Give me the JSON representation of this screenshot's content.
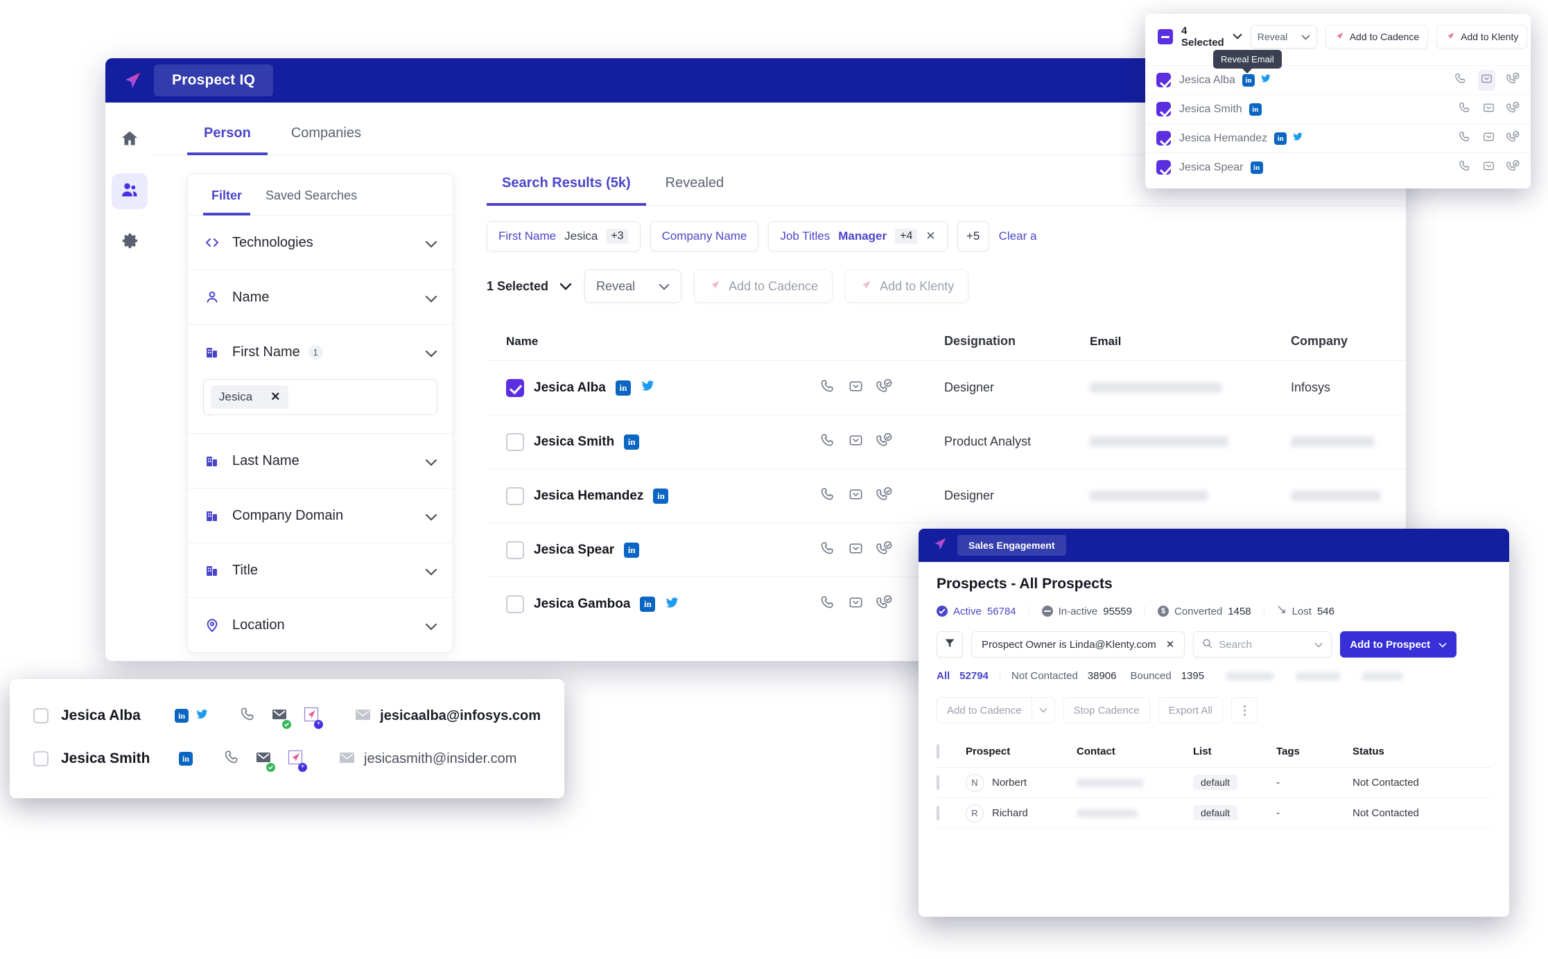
{
  "app": {
    "title": "Prospect IQ",
    "logo": "paper-plane-logo"
  },
  "rail": {
    "items": [
      {
        "name": "home",
        "icon": "home-icon",
        "active": false
      },
      {
        "name": "people",
        "icon": "people-icon",
        "active": true
      },
      {
        "name": "settings",
        "icon": "gear-icon",
        "active": false
      }
    ]
  },
  "top_tabs": [
    {
      "label": "Person",
      "active": true
    },
    {
      "label": "Companies",
      "active": false
    }
  ],
  "filter_panel": {
    "tabs": [
      {
        "label": "Filter",
        "active": true
      },
      {
        "label": "Saved Searches",
        "active": false
      }
    ],
    "rows": [
      {
        "label": "Technologies",
        "icon": "code-icon",
        "count": ""
      },
      {
        "label": "Name",
        "icon": "person-icon",
        "count": ""
      },
      {
        "label": "First Name",
        "icon": "building-icon",
        "count": "1"
      },
      {
        "label": "Last Name",
        "icon": "building-icon",
        "count": ""
      },
      {
        "label": "Company Domain",
        "icon": "building-icon",
        "count": ""
      },
      {
        "label": "Title",
        "icon": "building-icon",
        "count": ""
      },
      {
        "label": "Location",
        "icon": "pin-icon",
        "count": ""
      }
    ],
    "first_name_tag": "Jesica"
  },
  "results": {
    "tabs": [
      {
        "label": "Search Results (5k)",
        "active": true
      },
      {
        "label": "Revealed",
        "active": false
      }
    ],
    "chips": [
      {
        "label": "First Name",
        "value": "Jesica",
        "plus": "+3",
        "removable": false
      },
      {
        "label": "Company Name",
        "value": "",
        "plus": "",
        "removable": false
      },
      {
        "label": "Job Titles",
        "value": "Manager",
        "plus": "+4",
        "removable": true
      }
    ],
    "more_chip": "+5",
    "clear_all": "Clear a",
    "toolbar": {
      "selected": "1 Selected",
      "reveal": "Reveal",
      "add_to_cadence": "Add to Cadence",
      "add_to_klenty": "Add to Klenty"
    },
    "columns": [
      "Name",
      "Designation",
      "Email",
      "Company"
    ],
    "rows": [
      {
        "name": "Jesica Alba",
        "checked": true,
        "socials": [
          "linkedin",
          "twitter"
        ],
        "designation": "Designer",
        "email_blurred": true,
        "company": "Infosys",
        "company_blurred": false
      },
      {
        "name": "Jesica Smith",
        "checked": false,
        "socials": [
          "linkedin"
        ],
        "designation": "Product Analyst",
        "email_blurred": true,
        "company": "",
        "company_blurred": true
      },
      {
        "name": "Jesica Hemandez",
        "checked": false,
        "socials": [
          "linkedin"
        ],
        "designation": "Designer",
        "email_blurred": true,
        "company": "",
        "company_blurred": true
      },
      {
        "name": "Jesica Spear",
        "checked": false,
        "socials": [
          "linkedin"
        ],
        "designation": "",
        "email_blurred": false,
        "company": "",
        "company_blurred": false
      },
      {
        "name": "Jesica Gamboa",
        "checked": false,
        "socials": [
          "linkedin",
          "twitter"
        ],
        "designation": "",
        "email_blurred": false,
        "company": "",
        "company_blurred": false
      }
    ]
  },
  "overlay_top_right": {
    "selected": "4 Selected",
    "reveal": "Reveal",
    "add_to_cadence": "Add to Cadence",
    "add_to_klenty": "Add to Klenty",
    "tooltip": "Reveal Email",
    "rows": [
      {
        "name": "Jesica Alba",
        "socials": [
          "linkedin",
          "twitter"
        ],
        "highlight_email": true
      },
      {
        "name": "Jesica Smith",
        "socials": [
          "linkedin"
        ],
        "highlight_email": false
      },
      {
        "name": "Jesica Hemandez",
        "socials": [
          "linkedin",
          "twitter"
        ],
        "highlight_email": false
      },
      {
        "name": "Jesica Spear",
        "socials": [
          "linkedin"
        ],
        "highlight_email": false
      }
    ]
  },
  "overlay_bottom_left": {
    "rows": [
      {
        "name": "Jesica Alba",
        "socials": [
          "linkedin",
          "twitter"
        ],
        "email": "jesicaalba@infosys.com",
        "bold": true
      },
      {
        "name": "Jesica Smith",
        "socials": [
          "linkedin"
        ],
        "email": "jesicasmith@insider.com",
        "bold": false
      }
    ]
  },
  "overlay_bottom_right": {
    "app_pill": "Sales Engagement",
    "title": "Prospects - All Prospects",
    "stats": [
      {
        "label": "Active",
        "value": "56784",
        "icon": "check-circle-icon",
        "color": "#4a45c9",
        "active": true
      },
      {
        "label": "In-active",
        "value": "95559",
        "icon": "minus-circle-icon",
        "color": "#767c8a",
        "active": false
      },
      {
        "label": "Converted",
        "value": "1458",
        "icon": "dollar-circle-icon",
        "color": "#767c8a",
        "active": false
      },
      {
        "label": "Lost",
        "value": "546",
        "icon": "arrow-down-right-icon",
        "color": "#767c8a",
        "active": false
      }
    ],
    "filter_chip": "Prospect Owner is Linda@Klenty.com",
    "search_placeholder": "Search",
    "add_to_prospect": "Add to Prospect",
    "subfilters": [
      {
        "label": "All",
        "value": "52794",
        "active": true
      },
      {
        "label": "Not Contacted",
        "value": "38906",
        "active": false
      },
      {
        "label": "Bounced",
        "value": "1395",
        "active": false
      }
    ],
    "actions": {
      "add_to_cadence": "Add to Cadence",
      "stop_cadence": "Stop Cadence",
      "export_all": "Export All"
    },
    "columns": [
      "Prospect",
      "Contact",
      "List",
      "Tags",
      "Status"
    ],
    "rows": [
      {
        "initial": "N",
        "prospect": "Norbert",
        "list": "default",
        "tags": "-",
        "status": "Not Contacted"
      },
      {
        "initial": "R",
        "prospect": "Richard",
        "list": "default",
        "tags": "-",
        "status": "Not Contacted"
      }
    ]
  },
  "colors": {
    "navy": "#141fa0",
    "accent_purple": "#4a45c9",
    "check_purple": "#5b2ee0",
    "primary_button": "#3730d6",
    "linkedin": "#0a66c2",
    "twitter": "#1d9bf0"
  }
}
